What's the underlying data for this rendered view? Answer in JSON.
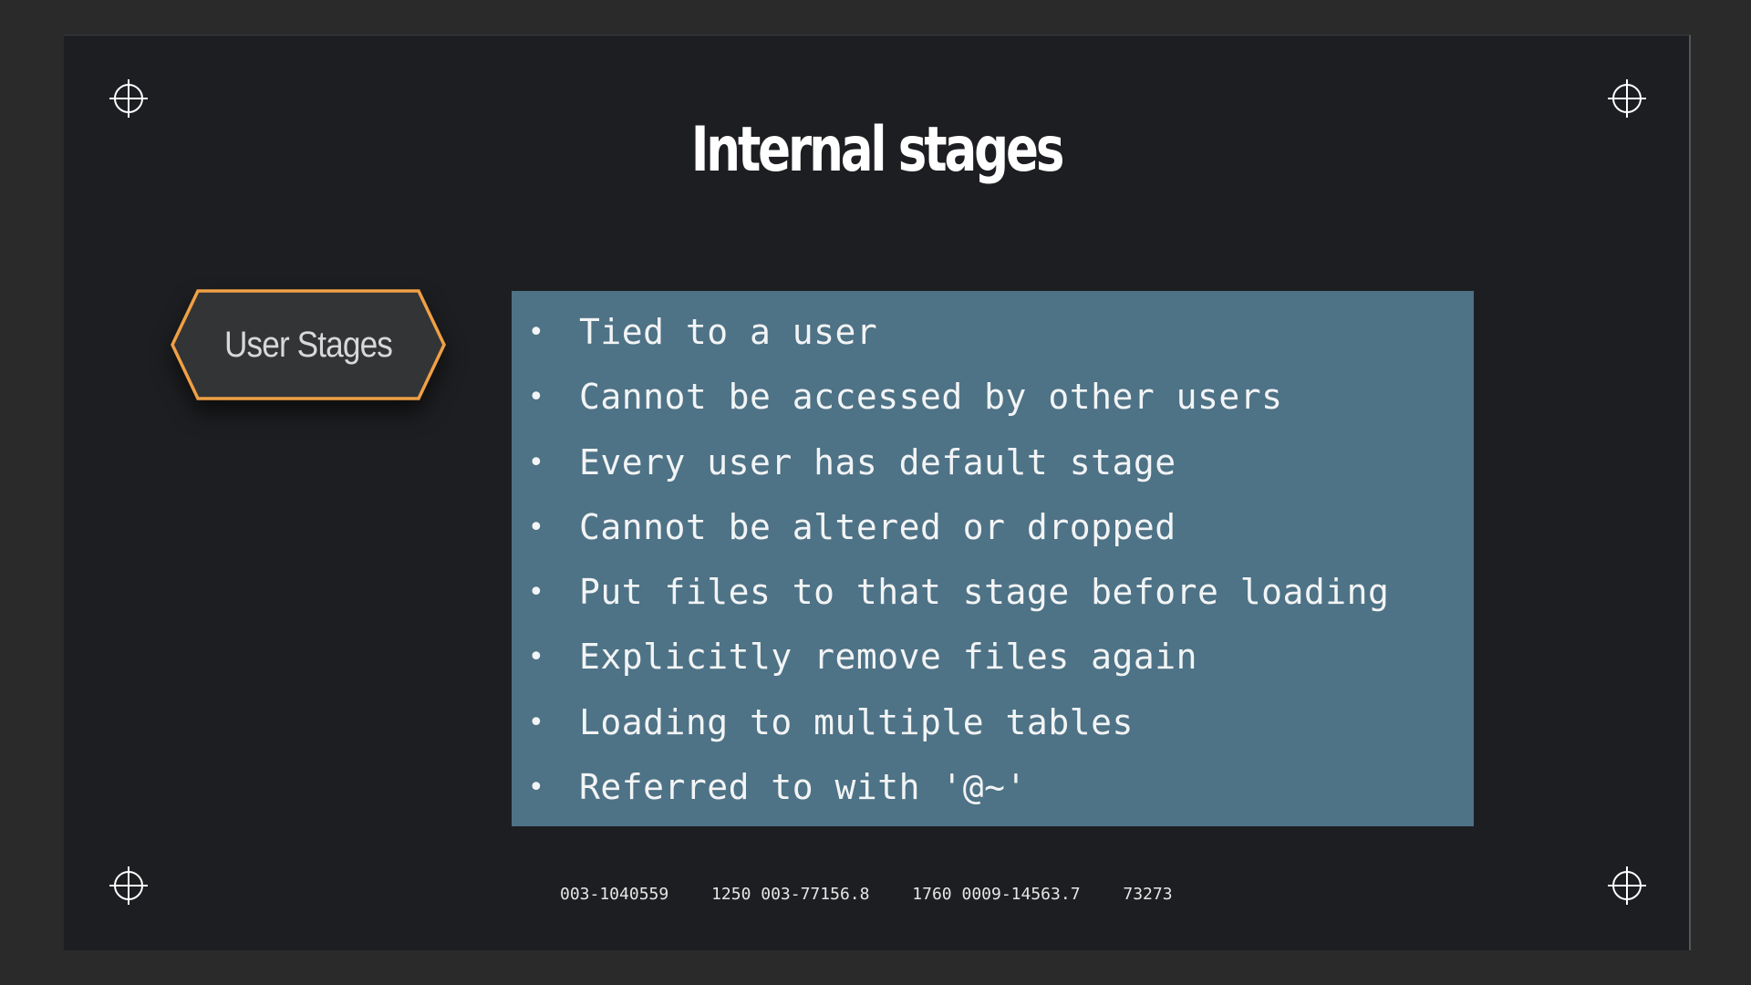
{
  "slide": {
    "title": "Internal stages",
    "tag": {
      "label": "User Stages",
      "border_color": "#f0a045",
      "fill_color": "#333436"
    },
    "bullets": [
      "Tied to a user",
      "Cannot be accessed by other users",
      "Every user has default stage",
      "Cannot be altered or dropped",
      "Put files to that stage before loading",
      "Explicitly remove files again",
      "Loading to multiple tables",
      "Referred to with '@~'"
    ],
    "bullet_box_color": "#4e7286",
    "footer": [
      "003-1040559",
      "1250 003-77156.8",
      "1760 0009-14563.7",
      "73273"
    ],
    "corner_icons": [
      "crosshair-icon",
      "crosshair-icon",
      "crosshair-icon",
      "crosshair-icon"
    ]
  }
}
